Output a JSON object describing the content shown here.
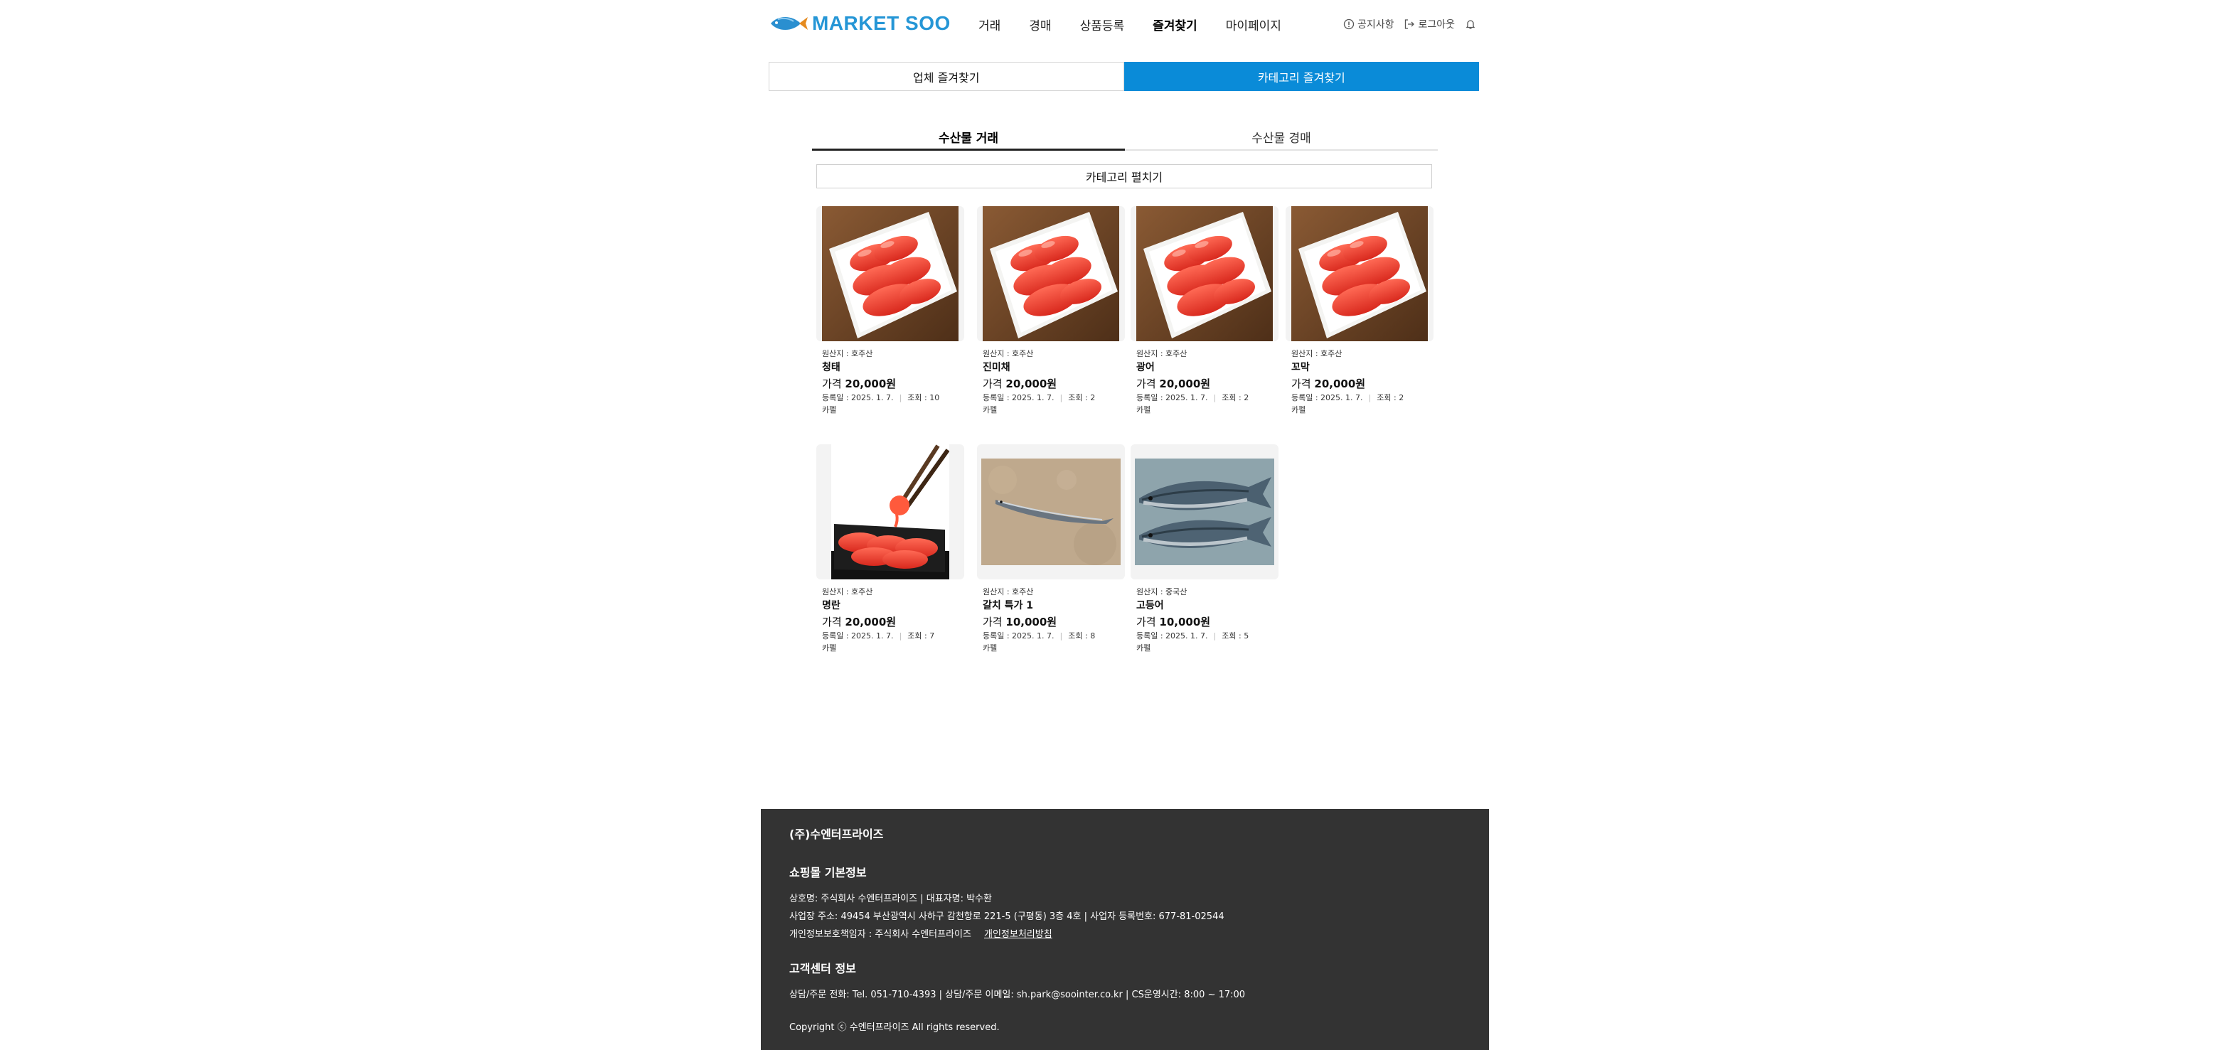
{
  "header": {
    "logo_text": "MARKET SOO",
    "nav": [
      "거래",
      "경매",
      "상품등록",
      "즐겨찾기",
      "마이페이지"
    ],
    "active_nav": "즐겨찾기",
    "notice_label": "공지사항",
    "logout_label": "로그아웃"
  },
  "top_tabs": [
    {
      "label": "업체 즐겨찾기",
      "active": false
    },
    {
      "label": "카테고리 즐겨찾기",
      "active": true
    }
  ],
  "sub_tabs": [
    {
      "label": "수산물 거래",
      "active": true
    },
    {
      "label": "수산물 경매",
      "active": false
    }
  ],
  "expand_label": "카테고리 펼치기",
  "products": [
    {
      "origin": "원산지 : 호주산",
      "name": "청태",
      "price_label": "가격",
      "price": "20,000원",
      "date": "등록일 : 2025. 1. 7.",
      "views": "조회 : 10",
      "unit": "카펠",
      "image": "roe-plate"
    },
    {
      "origin": "원산지 : 호주산",
      "name": "진미채",
      "price_label": "가격",
      "price": "20,000원",
      "date": "등록일 : 2025. 1. 7.",
      "views": "조회 : 2",
      "unit": "카펠",
      "image": "roe-plate"
    },
    {
      "origin": "원산지 : 호주산",
      "name": "광어",
      "price_label": "가격",
      "price": "20,000원",
      "date": "등록일 : 2025. 1. 7.",
      "views": "조회 : 2",
      "unit": "카펠",
      "image": "roe-plate"
    },
    {
      "origin": "원산지 : 호주산",
      "name": "꼬막",
      "price_label": "가격",
      "price": "20,000원",
      "date": "등록일 : 2025. 1. 7.",
      "views": "조회 : 2",
      "unit": "카펠",
      "image": "roe-plate"
    },
    {
      "origin": "원산지 : 호주산",
      "name": "명란",
      "price_label": "가격",
      "price": "20,000원",
      "date": "등록일 : 2025. 1. 7.",
      "views": "조회 : 7",
      "unit": "카펠",
      "image": "roe-chopsticks"
    },
    {
      "origin": "원산지 : 호주산",
      "name": "갈치 특가 1",
      "price_label": "가격",
      "price": "10,000원",
      "date": "등록일 : 2025. 1. 7.",
      "views": "조회 : 8",
      "unit": "카펠",
      "image": "saury-sand"
    },
    {
      "origin": "원산지 : 중국산",
      "name": "고등어",
      "price_label": "가격",
      "price": "10,000원",
      "date": "등록일 : 2025. 1. 7.",
      "views": "조회 : 5",
      "unit": "카펠",
      "image": "mackerel"
    }
  ],
  "footer": {
    "company": "(주)수엔터프라이즈",
    "shop_title": "쇼핑몰 기본정보",
    "line1": "상호명: 주식회사 수엔터프라이즈  |  대표자명: 박수환",
    "line2": "사업장 주소: 49454 부산광역시 사하구 감천항로 221-5 (구평동) 3층 4호  |  사업자 등록번호: 677-81-02544",
    "line3": "개인정보보호책임자 : 주식회사 수엔터프라이즈",
    "privacy_link": "개인정보처리방침",
    "cs_title": "고객센터 정보",
    "cs_line": "상담/주문 전화: Tel. 051-710-4393  |  상담/주문 이메일: sh.park@soointer.co.kr  |  CS운영시간: 8:00 ~ 17:00",
    "copyright": "Copyright ⓒ 수엔터프라이즈 All rights reserved."
  },
  "colors": {
    "accent": "#0a8bd8",
    "logo": "#2596d6",
    "footer_bg": "#333333"
  }
}
